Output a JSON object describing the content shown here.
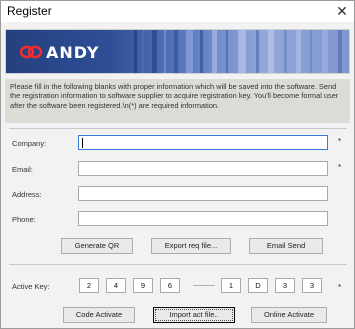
{
  "window": {
    "title": "Register",
    "close_symbol": "✕"
  },
  "banner": {
    "logo_text": "ANDY"
  },
  "info": {
    "text": "Please fill in the following blanks with proper information which will be saved into the software. Send the registration information to software supplier to acquire registration key. You'll become formal user after the software been registered.\\n(*) are required information."
  },
  "form": {
    "company": {
      "label": "Company:",
      "value": "",
      "required_mark": "*"
    },
    "email": {
      "label": "Email:",
      "value": "",
      "required_mark": "*"
    },
    "address": {
      "label": "Address:",
      "value": ""
    },
    "phone": {
      "label": "Phone:",
      "value": ""
    }
  },
  "buttons": {
    "generate_qr": "Generate QR",
    "export_req": "Export req file...",
    "email_send": "Email Send",
    "code_activate": "Code Activate",
    "import_act": "Import act file..",
    "online_activate": "Online Activate"
  },
  "active_key": {
    "label": "Active Key:",
    "required_mark": "*",
    "boxes": [
      "2",
      "4",
      "9",
      "6",
      "1",
      "D",
      "3",
      "3"
    ]
  },
  "colors": {
    "banner_dark": "#24407e",
    "banner_light": "#93a8d9",
    "focus_border": "#3b79d6",
    "info_bg": "#dcdbd6"
  }
}
